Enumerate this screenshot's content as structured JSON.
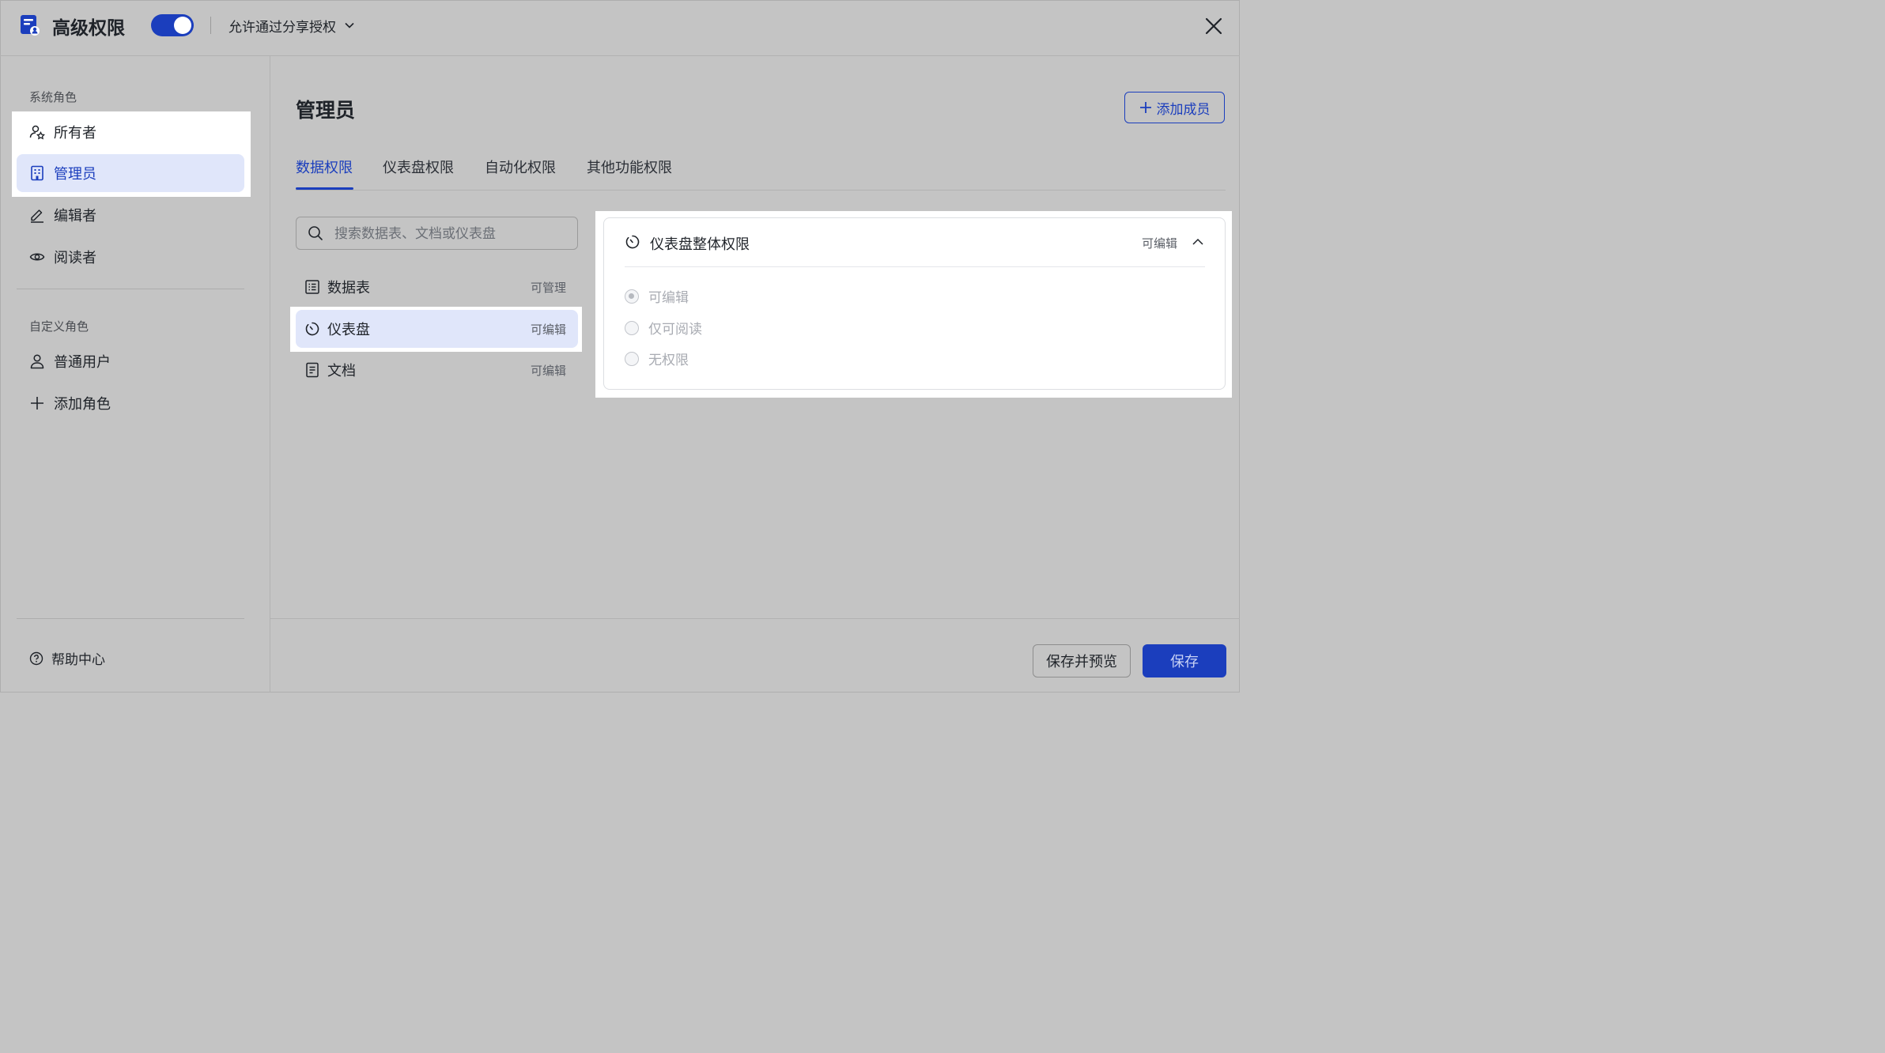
{
  "header": {
    "title": "高级权限",
    "toggle_on": true,
    "share_option": "允许通过分享授权"
  },
  "sidebar": {
    "system_roles_label": "系统角色",
    "system_roles": [
      {
        "label": "所有者",
        "icon": "owner-icon"
      },
      {
        "label": "管理员",
        "icon": "building-icon",
        "active": true
      },
      {
        "label": "编辑者",
        "icon": "pencil-icon"
      },
      {
        "label": "阅读者",
        "icon": "eye-icon"
      }
    ],
    "custom_roles_label": "自定义角色",
    "custom_roles": [
      {
        "label": "普通用户",
        "icon": "user-icon"
      },
      {
        "label": "添加角色",
        "icon": "plus-icon"
      }
    ],
    "help_label": "帮助中心"
  },
  "main": {
    "title": "管理员",
    "add_member_label": "添加成员",
    "tabs": [
      {
        "label": "数据权限",
        "active": true
      },
      {
        "label": "仪表盘权限"
      },
      {
        "label": "自动化权限"
      },
      {
        "label": "其他功能权限"
      }
    ],
    "search_placeholder": "搜索数据表、文档或仪表盘",
    "resources": [
      {
        "name": "数据表",
        "permission": "可管理",
        "icon": "table-icon"
      },
      {
        "name": "仪表盘",
        "permission": "可编辑",
        "icon": "dashboard-icon",
        "active": true
      },
      {
        "name": "文档",
        "permission": "可编辑",
        "icon": "document-icon"
      }
    ],
    "detail": {
      "title": "仪表盘整体权限",
      "permission": "可编辑",
      "options": [
        {
          "label": "可编辑",
          "selected": true
        },
        {
          "label": "仅可阅读",
          "selected": false
        },
        {
          "label": "无权限",
          "selected": false
        }
      ]
    }
  },
  "footer": {
    "preview_label": "保存并预览",
    "save_label": "保存"
  },
  "colors": {
    "accent": "#1b3ebd",
    "active_bg": "#e0e6fa",
    "overlay_bg": "#c4c4c4"
  }
}
